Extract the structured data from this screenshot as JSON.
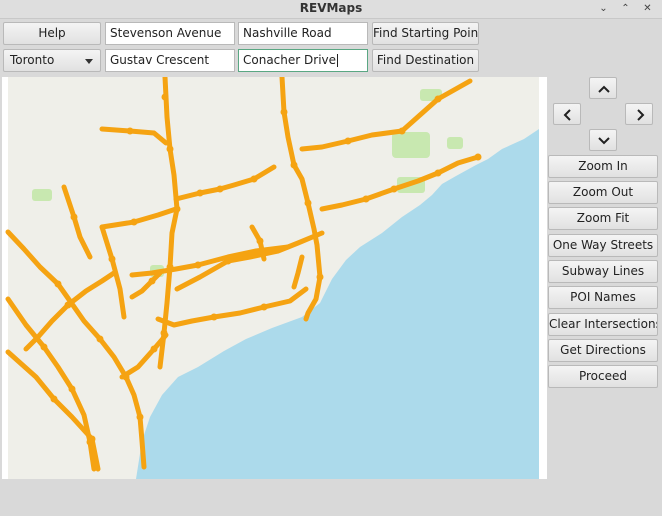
{
  "window": {
    "title": "REVMaps",
    "controls": [
      "chevron-down-icon",
      "chevron-up-icon",
      "close-icon"
    ]
  },
  "toolbar": {
    "help_label": "Help",
    "city_select_value": "Toronto",
    "start_street_1": "Stevenson Avenue",
    "start_street_2": "Nashville Road",
    "find_start_label": "Find Starting Point",
    "dest_street_1": "Gustav Crescent",
    "dest_street_2": "Conacher Drive",
    "find_dest_label": "Find Destination"
  },
  "nav": {
    "up_icon": "chevron-up-icon",
    "left_icon": "chevron-left-icon",
    "right_icon": "chevron-right-icon",
    "down_icon": "chevron-down-icon"
  },
  "side": {
    "buttons": [
      "Zoom In",
      "Zoom Out",
      "Zoom Fit",
      "One Way Streets",
      "Subway Lines",
      "POI Names",
      "Clear Intersections",
      "Get Directions",
      "Proceed"
    ]
  },
  "colors": {
    "water": "#acdaeb",
    "land": "#efefe9",
    "park": "#c8e8b0",
    "highway": "#f5a312"
  }
}
